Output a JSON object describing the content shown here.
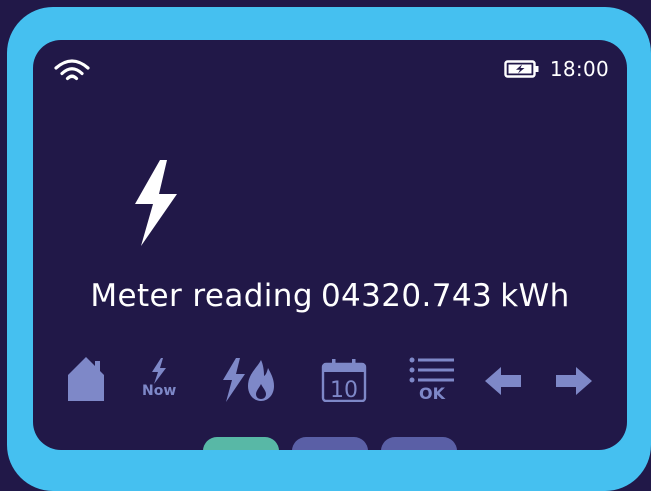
{
  "status": {
    "time": "18:00",
    "wifi_icon": "wifi-icon",
    "battery_icon": "battery-charging-icon"
  },
  "main": {
    "icon": "electricity-bolt-icon",
    "reading_label": "Meter reading",
    "reading_value": "04320.743",
    "reading_unit": "kWh"
  },
  "toolbar": {
    "home_icon": "house-icon",
    "now_label": "Now",
    "energy_icon": "electricity-gas-icon",
    "calendar_day": "10",
    "ok_label": "OK",
    "prev_icon": "arrow-left-icon",
    "next_icon": "arrow-right-icon"
  },
  "colors": {
    "screen_bg": "#211848",
    "frame": "#45c0f0",
    "icon": "#7e88c8",
    "tab_active": "#58b8a6",
    "tab_inactive": "#5a5fa6"
  }
}
